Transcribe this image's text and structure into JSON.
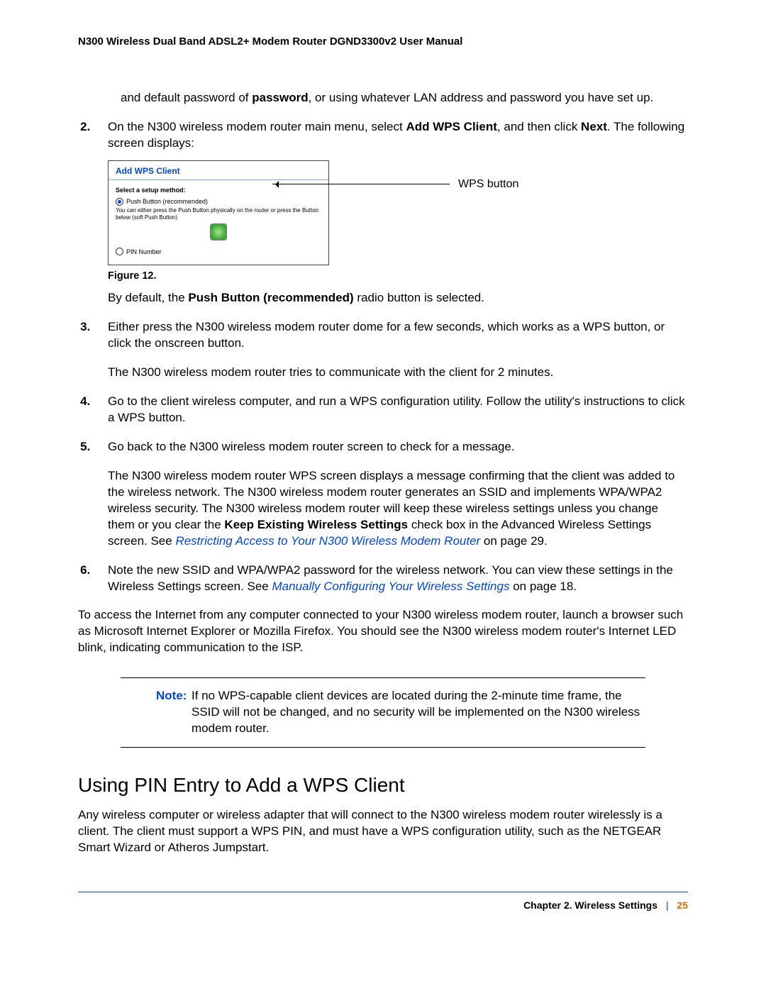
{
  "header": "N300 Wireless Dual Band ADSL2+ Modem Router DGND3300v2 User Manual",
  "intro_continuation": {
    "prefix": "and default password of ",
    "bold1": "password",
    "suffix": ", or using whatever LAN address and password you have set up."
  },
  "steps": {
    "s2": {
      "t1": "On the N300 wireless modem router main menu, select ",
      "b1": "Add WPS Client",
      "t2": ", and then click ",
      "b2": "Next",
      "t3": ". The following screen displays:"
    },
    "figure": {
      "title": "Add WPS Client",
      "select_label": "Select a setup method:",
      "opt1": "Push Button (recommended)",
      "desc": "You can either press the Push Button physically on the router or press the Button below (soft Push Button)",
      "opt2": "PIN Number",
      "callout": "WPS button",
      "caption": "Figure 12."
    },
    "after_fig": {
      "t1": "By default, the ",
      "b1": "Push Button (recommended)",
      "t2": " radio button is selected."
    },
    "s3": {
      "p1": "Either press the N300 wireless modem router dome for a few seconds, which works as a WPS button, or click the onscreen button.",
      "p2": "The N300 wireless modem router tries to communicate with the client for 2 minutes."
    },
    "s4": "Go to the client wireless computer, and run a WPS configuration utility. Follow the utility's instructions to click a WPS button.",
    "s5": {
      "p1": "Go back to the N300 wireless modem router screen to check for a message.",
      "p2a": "The N300 wireless modem router WPS screen displays a message confirming that the client was added to the wireless network. The N300 wireless modem router generates an SSID and implements WPA/WPA2 wireless security. The N300 wireless modem router will keep these wireless settings unless you change them or you clear the ",
      "p2b": "Keep Existing Wireless Settings",
      "p2c": " check box in the Advanced Wireless Settings screen. See ",
      "link": "Restricting Access to Your N300 Wireless Modem Router",
      "p2d": " on page 29."
    },
    "s6": {
      "t1": "Note the new SSID and WPA/WPA2 password for the wireless network. You can view these settings in the Wireless Settings screen. See ",
      "link": "Manually Configuring Your Wireless Settings",
      "t2": " on page 18."
    }
  },
  "closing": "To access the Internet from any computer connected to your N300 wireless modem router, launch a browser such as Microsoft Internet Explorer or Mozilla Firefox. You should see the N300 wireless modem router's Internet LED blink, indicating communication to the ISP.",
  "note": {
    "label": "Note:",
    "text": "If no WPS-capable client devices are located during the 2-minute time frame, the SSID will not be changed, and no security will be implemented on the N300 wireless modem router."
  },
  "section_heading": "Using PIN Entry to Add a WPS Client",
  "section_body": "Any wireless computer or wireless adapter that will connect to the N300 wireless modem router wirelessly is a client. The client must support a WPS PIN, and must have a WPS configuration utility, such as the NETGEAR Smart Wizard or Atheros Jumpstart.",
  "footer": {
    "chapter": "Chapter 2.  Wireless Settings",
    "sep": "|",
    "page": "25"
  }
}
